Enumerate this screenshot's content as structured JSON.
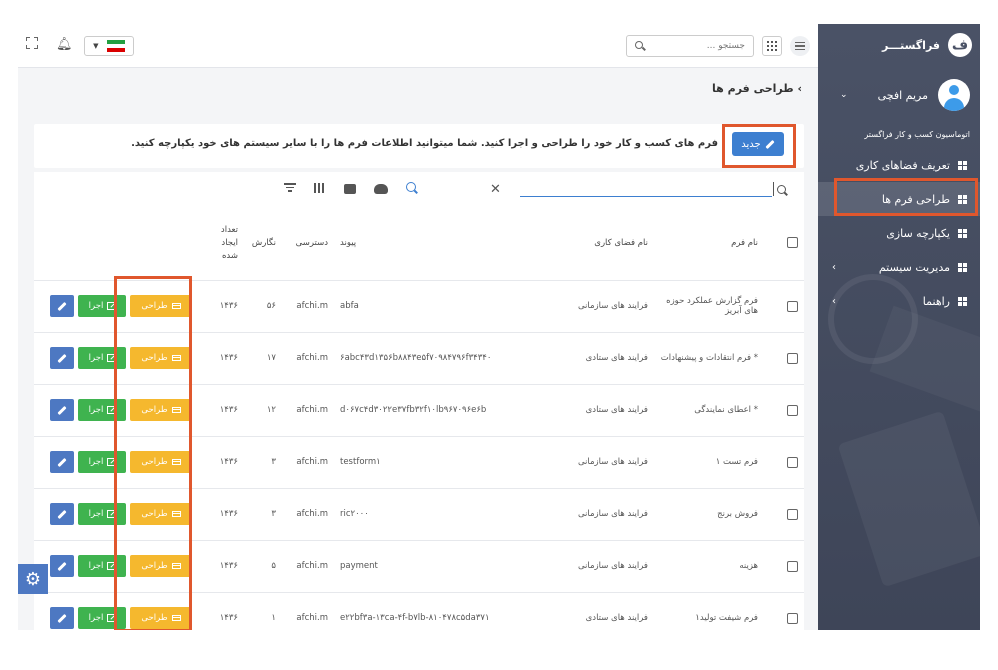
{
  "sidebar": {
    "brand": "فراگستـــر",
    "user_name": "مریم افچی",
    "subtitle": "اتوماسیون کسب و کار فراگستر",
    "items": [
      {
        "label": "تعریف فضاهای کاری",
        "has_submenu": false
      },
      {
        "label": "طراحی فرم ها",
        "has_submenu": false,
        "active": true
      },
      {
        "label": "یکپارچه سازی",
        "has_submenu": false
      },
      {
        "label": "مدیریت سیستم",
        "has_submenu": true
      },
      {
        "label": "راهنما",
        "has_submenu": true
      }
    ]
  },
  "topbar": {
    "search_placeholder": "جستجو ..."
  },
  "breadcrumb": "طراحی فرم ها",
  "card": {
    "new_button": "جدید",
    "description": "فرم های کسب و کار خود را طراحی و اجرا کنید. شما میتوانید اطلاعات فرم ها را با سایر سیستم های خود یکپارچه کنید."
  },
  "table": {
    "headers": {
      "form_name": "نام فرم",
      "workspace": "نام فضای کاری",
      "link": "پیوند",
      "access": "دسترسی",
      "version": "نگارش",
      "created_count": "تعداد ایجاد شده"
    },
    "action_labels": {
      "design": "طراحی",
      "run": "اجرا"
    },
    "rows": [
      {
        "form_name": "فرم گزارش عملکرد حوزه های آبریز",
        "workspace": "فرایند های سازمانی",
        "link": "abfa",
        "access": "afchi.m",
        "version": "۵۶",
        "created": "۱۴۳۶"
      },
      {
        "form_name": "* فرم انتقادات و پیشنهادات",
        "workspace": "فرایند های ستادی",
        "link": "۶abc۴۳d۱۳۵۶b۸۸۴۳e۵f۷۰۹۸۴۷۹۶f۳۴۳۴۰",
        "access": "afchi.m",
        "version": "۱۷",
        "created": "۱۴۳۶"
      },
      {
        "form_name": "* اعطای نمایندگی",
        "workspace": "فرایند های ستادی",
        "link": "d۰۶۷c۴d۳۰۲۲e۳۷fb۳۲f۱۰lb۹۶۷۰۹۶e۶b",
        "access": "afchi.m",
        "version": "۱۲",
        "created": "۱۴۳۶"
      },
      {
        "form_name": "فرم تست ۱",
        "workspace": "فرایند های سازمانی",
        "link": "testform۱",
        "access": "afchi.m",
        "version": "۳",
        "created": "۱۴۳۶"
      },
      {
        "form_name": "فروش برنج",
        "workspace": "فرایند های سازمانی",
        "link": "ric۲۰۰۰",
        "access": "afchi.m",
        "version": "۳",
        "created": "۱۴۳۶"
      },
      {
        "form_name": "هزینه",
        "workspace": "فرایند های سازمانی",
        "link": "payment",
        "access": "afchi.m",
        "version": "۵",
        "created": "۱۴۳۶"
      },
      {
        "form_name": "فرم شیفت تولید۱",
        "workspace": "فرایند های ستادی",
        "link": "e۲۲bf۳a-۱۳ca-۴f-b۷lb-۸۱۰۴۷۸c۵da۳۷۱",
        "access": "afchi.m",
        "version": "۱",
        "created": "۱۴۳۶"
      }
    ]
  },
  "colors": {
    "sidebar_bg": "#4a5266",
    "primary": "#3d7fd0",
    "design": "#f5b82e",
    "run": "#3fb34f",
    "edit": "#4d78c2",
    "highlight": "#e0572d"
  }
}
